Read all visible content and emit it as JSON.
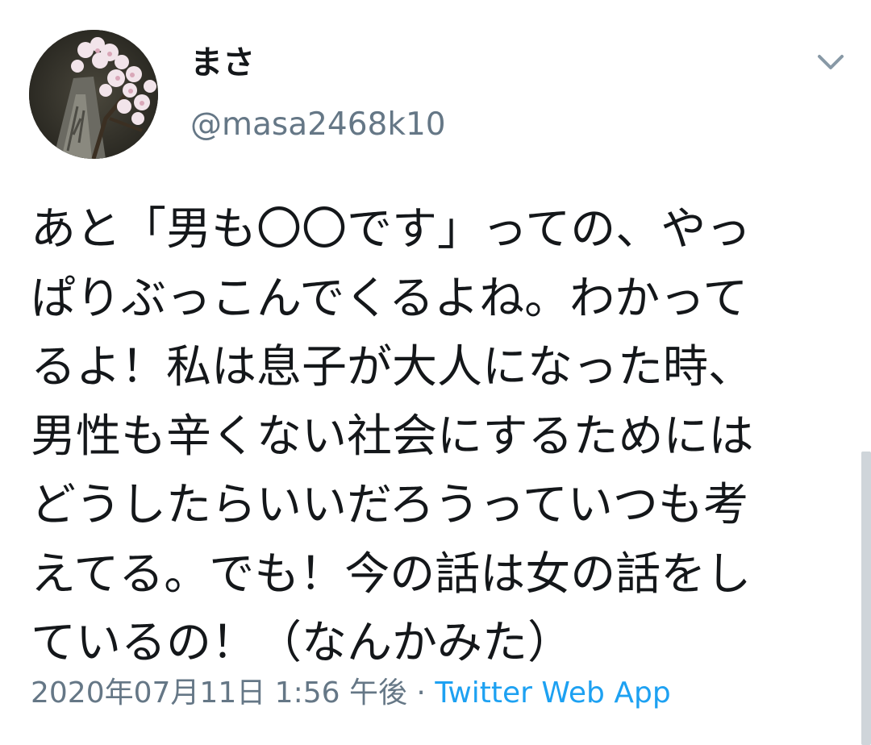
{
  "user": {
    "display_name": "まさ",
    "handle": "@masa2468k10"
  },
  "tweet": {
    "lines": [
      "あと「男も〇〇です」っての、やっ",
      "ぱりぶっこんでくるよね。わかって",
      "るよ！私は息子が大人になった時、",
      "男性も辛くない社会にするためには",
      "どうしたらいいだろうっていつも考",
      "えてる。でも！今の話は女の話をし",
      "ているの！（なんかみた）"
    ],
    "timestamp": "2020年07月11日 1:56 午後",
    "separator": " · ",
    "source": "Twitter Web App"
  },
  "icons": {
    "caret": "chevron-down-icon",
    "avatar": "cherry-blossom-photo"
  },
  "colors": {
    "text": "#14171a",
    "secondary": "#657786",
    "link": "#1da1f2"
  }
}
